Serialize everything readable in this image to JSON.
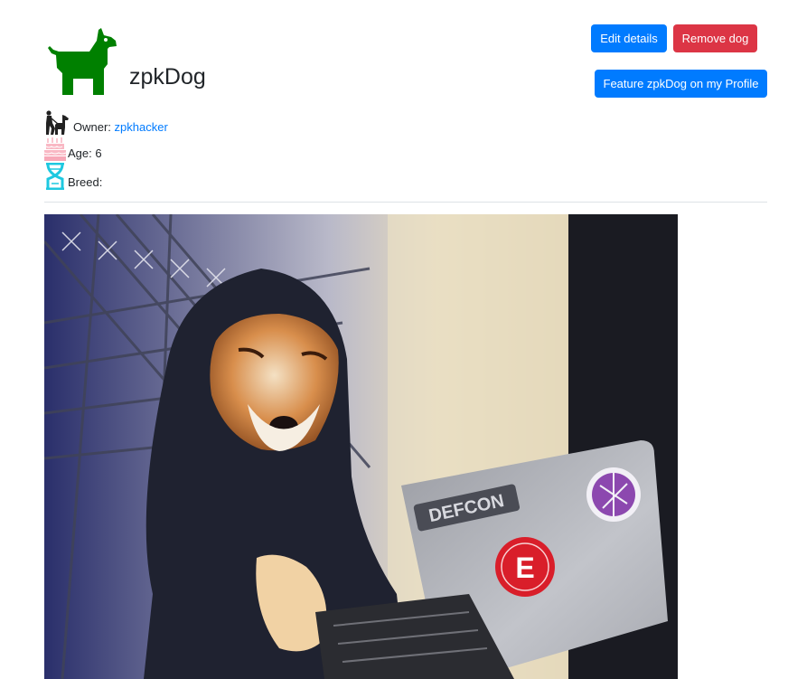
{
  "dog": {
    "name": "zpkDog",
    "owner_label": "Owner:",
    "owner_name": "zpkhacker",
    "age_label": "Age:",
    "age_value": "6",
    "breed_label": "Breed:",
    "breed_value": ""
  },
  "actions": {
    "edit_label": "Edit details",
    "remove_label": "Remove dog",
    "feature_label": "Feature zpkDog on my Profile"
  },
  "photo": {
    "sticker_text": "DEFCON",
    "sticker_letter": "E"
  },
  "icons": {
    "logo": "dog-icon",
    "owner": "dog-walker-icon",
    "age": "birthday-cake-icon",
    "breed": "dna-icon"
  },
  "colors": {
    "logo_green": "#008000",
    "primary": "#007bff",
    "danger": "#dc3545",
    "cake_pink": "#f9b8c4",
    "dna_cyan": "#1ec8e0"
  }
}
